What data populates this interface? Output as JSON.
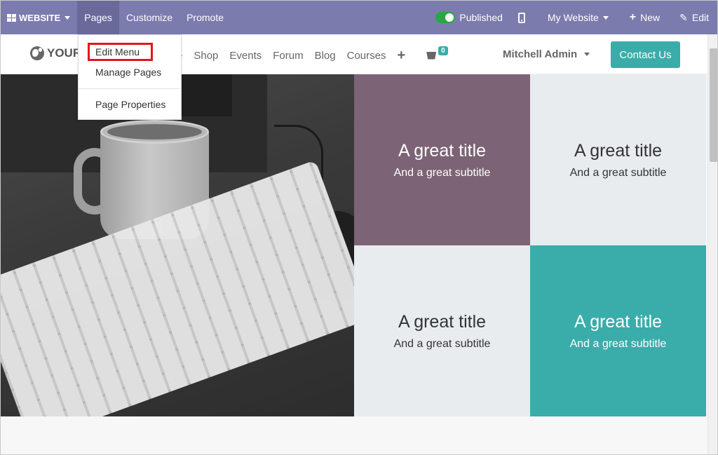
{
  "topbar": {
    "app_label": "WEBSITE",
    "pages_label": "Pages",
    "customize_label": "Customize",
    "promote_label": "Promote",
    "published_label": "Published",
    "my_website_label": "My Website",
    "new_label": "New",
    "edit_label": "Edit"
  },
  "pages_menu": {
    "edit_menu": "Edit Menu",
    "manage_pages": "Manage Pages",
    "page_properties": "Page Properties"
  },
  "site_header": {
    "logo_text": "YOUR",
    "nav": [
      "e",
      "Shop",
      "Events",
      "Forum",
      "Blog",
      "Courses"
    ],
    "cart_count": "0",
    "user_name": "Mitchell Admin",
    "contact_label": "Contact Us"
  },
  "tiles": [
    {
      "title": "A great title",
      "subtitle": "And a great subtitle"
    },
    {
      "title": "A great title",
      "subtitle": "And a great subtitle"
    },
    {
      "title": "A great title",
      "subtitle": "And a great subtitle"
    },
    {
      "title": "A great title",
      "subtitle": "And a great subtitle"
    }
  ],
  "colors": {
    "topbar": "#7c7bad",
    "accent": "#3aadaa",
    "tile_mauve": "#7c6375",
    "tile_gray": "#e9ecef",
    "highlight": "#e3151f",
    "published_toggle": "#28a745"
  },
  "icons": [
    "apps-grid-icon",
    "toggle-icon",
    "mobile-icon",
    "plus-icon",
    "pencil-icon",
    "globe-icon",
    "cart-icon"
  ]
}
